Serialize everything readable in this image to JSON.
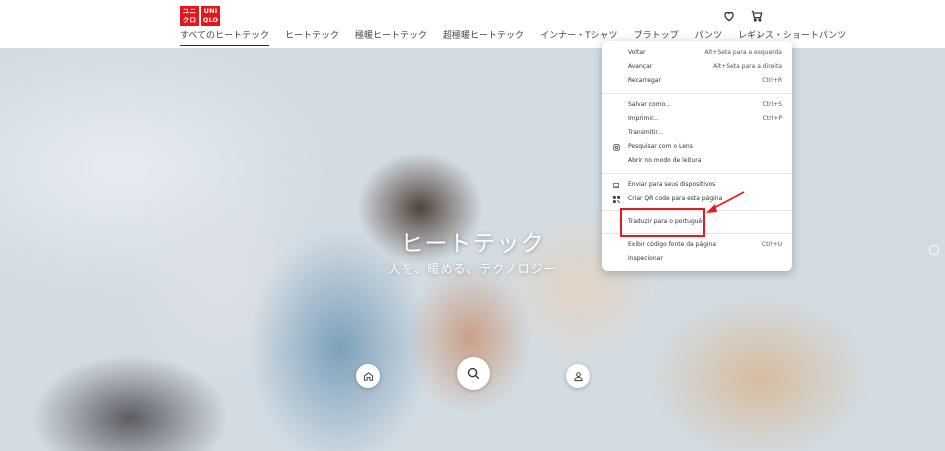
{
  "header": {
    "logo_top": "ユニ",
    "logo_bottom": "クロ",
    "logo_en_top": "UNI",
    "logo_en_bottom": "QLO",
    "icons": [
      "heart-icon",
      "cart-icon"
    ]
  },
  "nav": {
    "items": [
      {
        "label": "すべてのヒートテック",
        "active": true
      },
      {
        "label": "ヒートテック",
        "active": false
      },
      {
        "label": "極暖ヒートテック",
        "active": false
      },
      {
        "label": "超極暖ヒートテック",
        "active": false
      },
      {
        "label": "インナー・Tシャツ",
        "active": false
      },
      {
        "label": "ブラトップ",
        "active": false
      },
      {
        "label": "パンツ",
        "active": false
      },
      {
        "label": "レギンス・ショートパンツ",
        "active": false
      }
    ],
    "more_glyph": "›"
  },
  "hero": {
    "title": "ヒートテック",
    "subtitle": "人を、暖める、テクノロジー",
    "buttons": [
      "home-icon",
      "search-icon",
      "user-icon"
    ]
  },
  "context_menu": {
    "items": [
      {
        "label": "Voltar",
        "shortcut": "Alt+Seta para a esquerda"
      },
      {
        "label": "Avançar",
        "shortcut": "Alt+Seta para a direita"
      },
      {
        "label": "Recarregar",
        "shortcut": "Ctrl+R"
      },
      {
        "separator": true
      },
      {
        "label": "Salvar como...",
        "shortcut": "Ctrl+S"
      },
      {
        "label": "Imprimir...",
        "shortcut": "Ctrl+P"
      },
      {
        "label": "Transmitir...",
        "shortcut": ""
      },
      {
        "label": "Pesquisar com o Lens",
        "shortcut": "",
        "icon": "lens-icon"
      },
      {
        "label": "Abrir no modo de leitura",
        "shortcut": ""
      },
      {
        "separator": true
      },
      {
        "label": "Enviar para seus dispositivos",
        "shortcut": "",
        "icon": "devices-icon"
      },
      {
        "label": "Criar QR code para esta página",
        "shortcut": "",
        "icon": "qr-code-icon"
      },
      {
        "separator": true
      },
      {
        "label": "Traduzir para o português",
        "shortcut": "",
        "highlighted": true
      },
      {
        "separator": true
      },
      {
        "label": "Exibir código fonte da página",
        "shortcut": "Ctrl+U"
      },
      {
        "label": "Inspecionar",
        "shortcut": ""
      }
    ]
  },
  "annotation": {
    "highlight_color": "#e11d22"
  }
}
